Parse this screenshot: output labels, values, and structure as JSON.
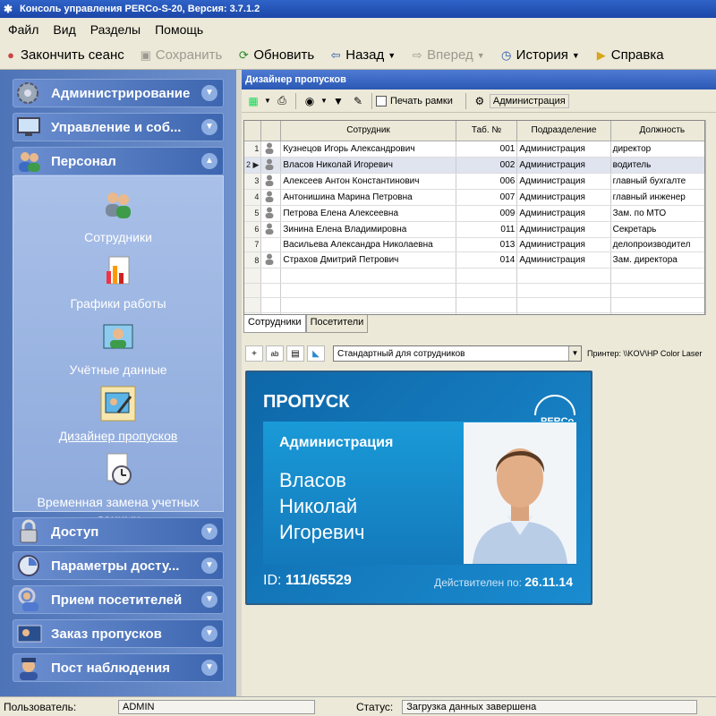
{
  "window": {
    "title": "Консоль управления PERCo-S-20, Версия: 3.7.1.2"
  },
  "menu": [
    "Файл",
    "Вид",
    "Разделы",
    "Помощь"
  ],
  "toolbar": {
    "logout": "Закончить сеанс",
    "save": "Сохранить",
    "refresh": "Обновить",
    "back": "Назад",
    "forward": "Вперед",
    "history": "История",
    "help": "Справка"
  },
  "nav": {
    "sections": [
      {
        "label": "Администрирование",
        "icon": "gear-icon"
      },
      {
        "label": "Управление и соб...",
        "icon": "monitor-icon"
      },
      {
        "label": "Персонал",
        "icon": "people-icon"
      },
      {
        "label": "Доступ",
        "icon": "lock-icon"
      },
      {
        "label": "Параметры досту...",
        "icon": "clock-icon"
      },
      {
        "label": "Прием посетителей",
        "icon": "visitor-icon"
      },
      {
        "label": "Заказ пропусков",
        "icon": "badge-order-icon"
      },
      {
        "label": "Пост наблюдения",
        "icon": "guard-icon"
      }
    ],
    "personnel_items": [
      {
        "label": "Сотрудники",
        "icon": "employees-icon"
      },
      {
        "label": "Графики работы",
        "icon": "schedule-chart-icon"
      },
      {
        "label": "Учётные данные",
        "icon": "credentials-icon"
      },
      {
        "label": "Дизайнер пропусков",
        "icon": "badge-designer-icon"
      },
      {
        "label": "Временная замена учетных данных",
        "icon": "temporary-replacement-icon"
      }
    ]
  },
  "module": {
    "title": "Дизайнер пропусков",
    "print_frames_label": "Печать рамки",
    "department_button": "Администрация",
    "columns": [
      "Сотрудник",
      "Таб. №",
      "Подразделение",
      "Должность"
    ],
    "rows": [
      {
        "n": "1",
        "name": "Кузнецов Игорь Александрович",
        "tab": "001",
        "dept": "Администрация",
        "pos": "директор",
        "photo": true
      },
      {
        "n": "2",
        "name": "Власов Николай Игоревич",
        "tab": "002",
        "dept": "Администрация",
        "pos": "водитель",
        "photo": true
      },
      {
        "n": "3",
        "name": "Алексеев Антон Константинович",
        "tab": "006",
        "dept": "Администрация",
        "pos": "главный бухгалте",
        "photo": true
      },
      {
        "n": "4",
        "name": "Антонишина Марина Петровна",
        "tab": "007",
        "dept": "Администрация",
        "pos": "главный инженер",
        "photo": true
      },
      {
        "n": "5",
        "name": "Петрова Елена Алексеевна",
        "tab": "009",
        "dept": "Администрация",
        "pos": "Зам. по МТО",
        "photo": true
      },
      {
        "n": "6",
        "name": "Зинина Елена Владимировна",
        "tab": "011",
        "dept": "Администрация",
        "pos": "Секретарь",
        "photo": true
      },
      {
        "n": "7",
        "name": "Васильева Александра Николаевна",
        "tab": "013",
        "dept": "Администрация",
        "pos": "делопроизводител",
        "photo": false
      },
      {
        "n": "8",
        "name": "Страхов Дмитрий Петрович",
        "tab": "014",
        "dept": "Администрация",
        "pos": "Зам. директора",
        "photo": true
      }
    ],
    "last_row_number": "8",
    "tabs": [
      "Сотрудники",
      "Посетители"
    ],
    "template_select": "Стандартный для сотрудников",
    "printer": "Принтер: \\\\KOV\\HP Color Laser"
  },
  "badge": {
    "title": "ПРОПУСК",
    "logo": "PERCo",
    "department": "Администрация",
    "surname": "Власов",
    "firstname": "Николай",
    "patronymic": "Игоревич",
    "id_label": "ID:",
    "id_value": "111/65529",
    "valid_label": "Действителен по:",
    "valid_date": "26.11.14"
  },
  "status": {
    "user_label": "Пользователь:",
    "user": "ADMIN",
    "status_label": "Статус:",
    "status_text": "Загрузка данных завершена"
  },
  "colors": {
    "nav_bg": "#5a7fc2",
    "title_bar": "#2a58b4",
    "badge": "#1379bb"
  }
}
